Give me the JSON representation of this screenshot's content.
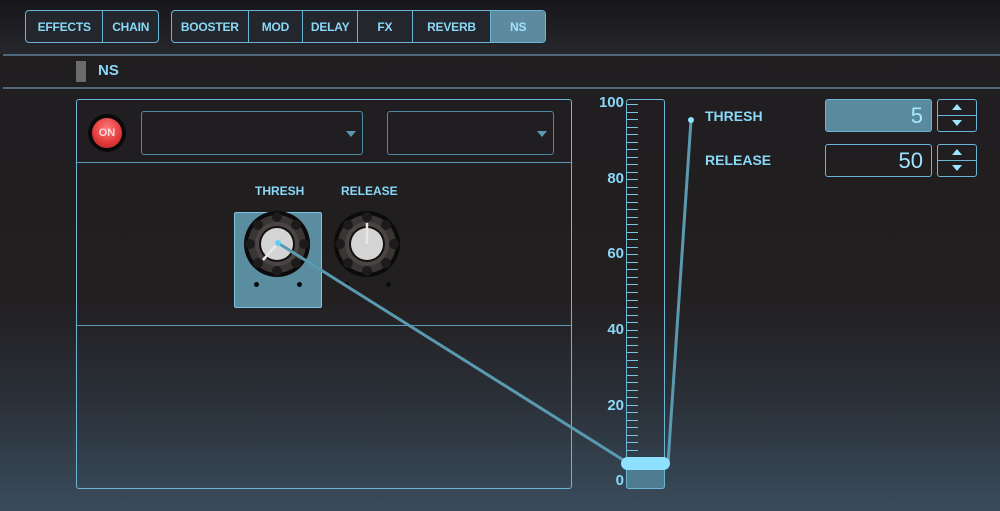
{
  "tabs": {
    "group1": [
      {
        "label": "EFFECTS",
        "active": false
      },
      {
        "label": "CHAIN",
        "active": false
      }
    ],
    "group2": [
      {
        "label": "BOOSTER",
        "active": false
      },
      {
        "label": "MOD",
        "active": false
      },
      {
        "label": "DELAY",
        "active": false
      },
      {
        "label": "FX",
        "active": false
      },
      {
        "label": "REVERB",
        "active": false
      },
      {
        "label": "NS",
        "active": true
      }
    ]
  },
  "section": {
    "title": "NS"
  },
  "panel": {
    "on_button": {
      "label": "ON",
      "state": "on",
      "color": "#e03838"
    },
    "dropdown1": {
      "value": ""
    },
    "dropdown2": {
      "value": ""
    },
    "knobs": [
      {
        "label": "THRESH",
        "value": 5,
        "selected": true
      },
      {
        "label": "RELEASE",
        "value": 50,
        "selected": false
      }
    ]
  },
  "slider": {
    "scale_labels": [
      "100",
      "80",
      "60",
      "40",
      "20",
      "0"
    ],
    "min": 0,
    "max": 100,
    "value": 5
  },
  "params": [
    {
      "label": "THRESH",
      "value": "5",
      "active": true
    },
    {
      "label": "RELEASE",
      "value": "50",
      "active": false
    }
  ],
  "colors": {
    "accent": "#7dd3f5",
    "active_tab": "#5d8a9e",
    "handle": "#8ee0ff"
  }
}
